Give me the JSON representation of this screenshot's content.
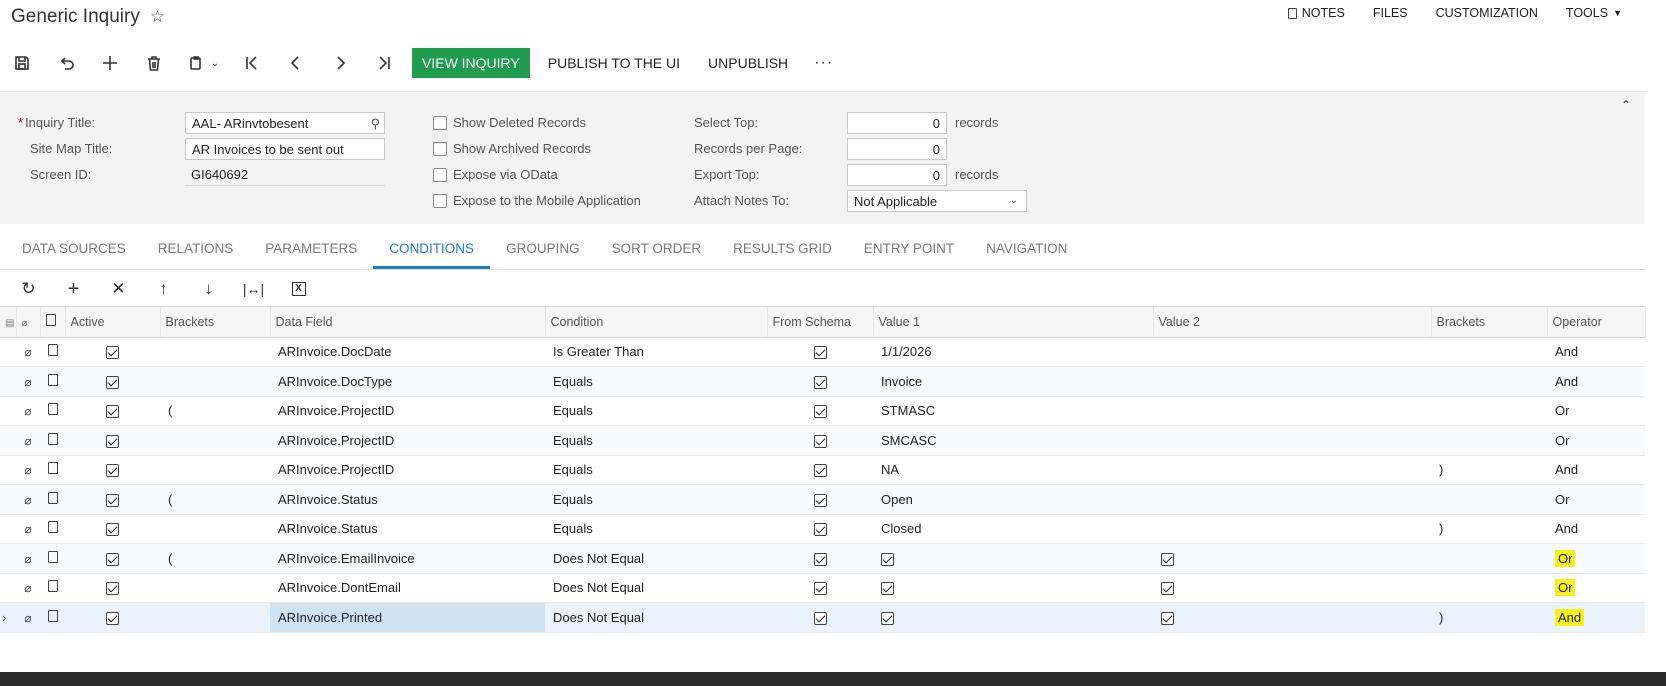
{
  "title": "Generic Inquiry",
  "top_menu": [
    "NOTES",
    "FILES",
    "CUSTOMIZATION",
    "TOOLS"
  ],
  "toolbar": {
    "view_inquiry": "VIEW INQUIRY",
    "publish": "PUBLISH TO THE UI",
    "unpublish": "UNPUBLISH",
    "more": "···"
  },
  "form": {
    "inquiry_title_label": "Inquiry Title:",
    "inquiry_title_value": "AAL- ARinvtobesent",
    "site_map_title_label": "Site Map Title:",
    "site_map_title_value": "AR Invoices to be sent out",
    "screen_id_label": "Screen ID:",
    "screen_id_value": "GI640692",
    "show_deleted": "Show Deleted Records",
    "show_archived": "Show Archived Records",
    "expose_odata": "Expose via OData",
    "expose_mobile": "Expose to the Mobile Application",
    "select_top_label": "Select Top:",
    "select_top_value": "0",
    "select_top_unit": "records",
    "records_per_page_label": "Records per Page:",
    "records_per_page_value": "0",
    "export_top_label": "Export Top:",
    "export_top_value": "0",
    "export_top_unit": "records",
    "attach_notes_label": "Attach Notes To:",
    "attach_notes_value": "Not Applicable"
  },
  "tabs": [
    "DATA SOURCES",
    "RELATIONS",
    "PARAMETERS",
    "CONDITIONS",
    "GROUPING",
    "SORT ORDER",
    "RESULTS GRID",
    "ENTRY POINT",
    "NAVIGATION"
  ],
  "active_tab": "CONDITIONS",
  "grid": {
    "headers": [
      "Active",
      "Brackets",
      "Data Field",
      "Condition",
      "From Schema",
      "Value 1",
      "Value 2",
      "Brackets",
      "Operator"
    ],
    "rows": [
      {
        "active": true,
        "open": "",
        "field": "ARInvoice.DocDate",
        "condition": "Is Greater Than",
        "schema": true,
        "v1": "1/1/2026",
        "v1cb": false,
        "v2cb": false,
        "close": "",
        "op": "And"
      },
      {
        "active": true,
        "open": "",
        "field": "ARInvoice.DocType",
        "condition": "Equals",
        "schema": true,
        "v1": "Invoice",
        "v1cb": false,
        "v2cb": false,
        "close": "",
        "op": "And"
      },
      {
        "active": true,
        "open": "(",
        "field": "ARInvoice.ProjectID",
        "condition": "Equals",
        "schema": true,
        "v1": "STMASC",
        "v1cb": false,
        "v2cb": false,
        "close": "",
        "op": "Or"
      },
      {
        "active": true,
        "open": "",
        "field": "ARInvoice.ProjectID",
        "condition": "Equals",
        "schema": true,
        "v1": "SMCASC",
        "v1cb": false,
        "v2cb": false,
        "close": "",
        "op": "Or"
      },
      {
        "active": true,
        "open": "",
        "field": "ARInvoice.ProjectID",
        "condition": "Equals",
        "schema": true,
        "v1": "NA",
        "v1cb": false,
        "v2cb": false,
        "close": ")",
        "op": "And"
      },
      {
        "active": true,
        "open": "(",
        "field": "ARInvoice.Status",
        "condition": "Equals",
        "schema": true,
        "v1": "Open",
        "v1cb": false,
        "v2cb": false,
        "close": "",
        "op": "Or"
      },
      {
        "active": true,
        "open": "",
        "field": "ARInvoice.Status",
        "condition": "Equals",
        "schema": true,
        "v1": "Closed",
        "v1cb": false,
        "v2cb": false,
        "close": ")",
        "op": "And"
      },
      {
        "active": true,
        "open": "(",
        "field": "ARInvoice.EmailInvoice",
        "condition": "Does Not Equal",
        "schema": true,
        "v1": "",
        "v1cb": true,
        "v2cb": true,
        "close": "",
        "op": "Or",
        "highlight": true
      },
      {
        "active": true,
        "open": "",
        "field": "ARInvoice.DontEmail",
        "condition": "Does Not Equal",
        "schema": true,
        "v1": "",
        "v1cb": true,
        "v2cb": true,
        "close": "",
        "op": "Or",
        "highlight": true
      },
      {
        "active": true,
        "open": "",
        "field": "ARInvoice.Printed",
        "condition": "Does Not Equal",
        "schema": true,
        "v1": "",
        "v1cb": true,
        "v2cb": true,
        "close": ")",
        "op": "And",
        "highlight": true,
        "selected": true
      }
    ]
  },
  "colors": {
    "primary_button": "#1f9c4d",
    "active_tab": "#1d7ec2",
    "highlight": "#f4f21a"
  }
}
